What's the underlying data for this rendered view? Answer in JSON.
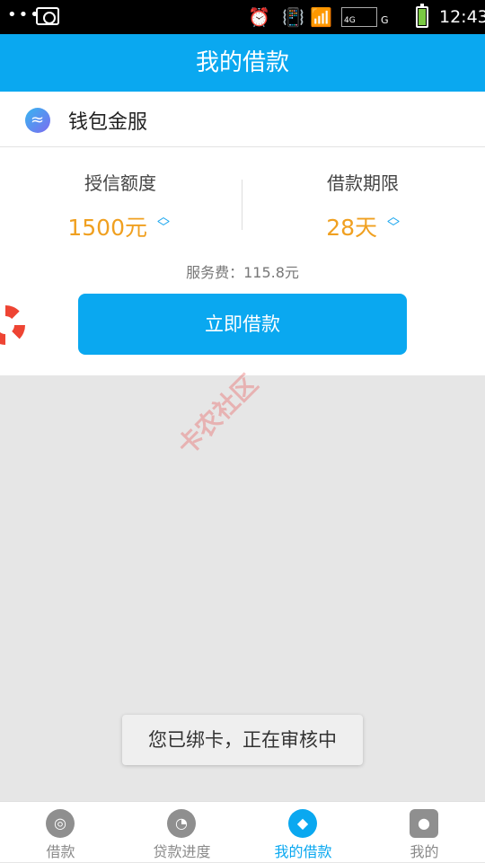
{
  "status_bar": {
    "dots": "•••",
    "network_4g": "4G",
    "network_g": "G",
    "time": "12:43"
  },
  "header": {
    "title": "我的借款"
  },
  "provider": {
    "name": "钱包金服"
  },
  "loan": {
    "credit_label": "授信额度",
    "credit_value": "1500元",
    "term_label": "借款期限",
    "term_value": "28天",
    "fee_label": "服务费：",
    "fee_value": "115.8元",
    "borrow_button": "立即借款"
  },
  "watermark": {
    "text": "卡农社区"
  },
  "toast": {
    "message": "您已绑卡，正在审核中"
  },
  "tabs": [
    {
      "label": "借款",
      "icon": "medal-icon",
      "active": false
    },
    {
      "label": "贷款进度",
      "icon": "clock-icon",
      "active": false
    },
    {
      "label": "我的借款",
      "icon": "diamond-icon",
      "active": true
    },
    {
      "label": "我的",
      "icon": "person-icon",
      "active": false
    }
  ],
  "colors": {
    "accent": "#0aa8f0",
    "amount": "#f0a020"
  }
}
